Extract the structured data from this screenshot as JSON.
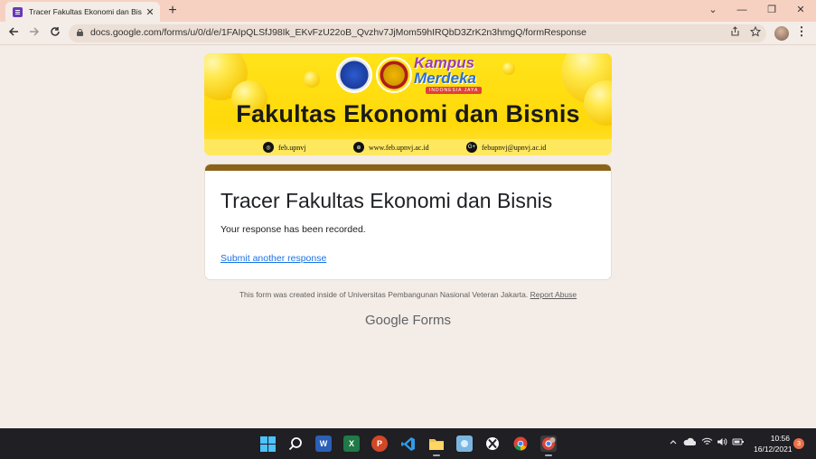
{
  "browser": {
    "tab_title": "Tracer Fakultas Ekonomi dan Bisnis",
    "tab_close": "✕",
    "new_tab": "+",
    "url": "docs.google.com/forms/u/0/d/e/1FAIpQLSfJ98Ik_EKvFzU22oB_Qvzhv7JjMom59hIRQbD3ZrK2n3hmgQ/formResponse",
    "window_controls": {
      "dropdown": "⌄",
      "minimize": "—",
      "restore": "❐",
      "close": "✕"
    }
  },
  "banner": {
    "kampus_line1": "Kampus",
    "kampus_line2": "Merdeka",
    "kampus_tagline": "INDONESIA JAYA",
    "heading": "Fakultas Ekonomi dan Bisnis",
    "socials": [
      {
        "icon": "instagram-icon",
        "glyph": "◎",
        "text": "feb.upnvj"
      },
      {
        "icon": "web-icon",
        "glyph": "⊕",
        "text": "www.feb.upnvj.ac.id"
      },
      {
        "icon": "google-plus-icon",
        "glyph": "G+",
        "text": "febupnvj@upnvj.ac.id"
      }
    ]
  },
  "form": {
    "title": "Tracer Fakultas Ekonomi dan Bisnis",
    "confirmation": "Your response has been recorded.",
    "submit_another": "Submit another response",
    "accent_color": "#8a6218"
  },
  "footer": {
    "created_note": "This form was created inside of Universitas Pembangunan Nasional Veteran Jakarta.",
    "report_abuse": "Report Abuse",
    "brand_google": "Google",
    "brand_forms": "Forms"
  },
  "taskbar": {
    "apps": [
      "windows-start-icon",
      "search-icon",
      "word-icon",
      "excel-icon",
      "powerpoint-icon",
      "vscode-icon",
      "file-explorer-icon",
      "photos-icon",
      "xbox-icon",
      "chrome-icon",
      "chrome-profile-icon"
    ],
    "word_glyph": "W",
    "excel_glyph": "X",
    "ppt_glyph": "P",
    "time": "10:56",
    "date": "16/12/2021",
    "notifications": "3"
  }
}
